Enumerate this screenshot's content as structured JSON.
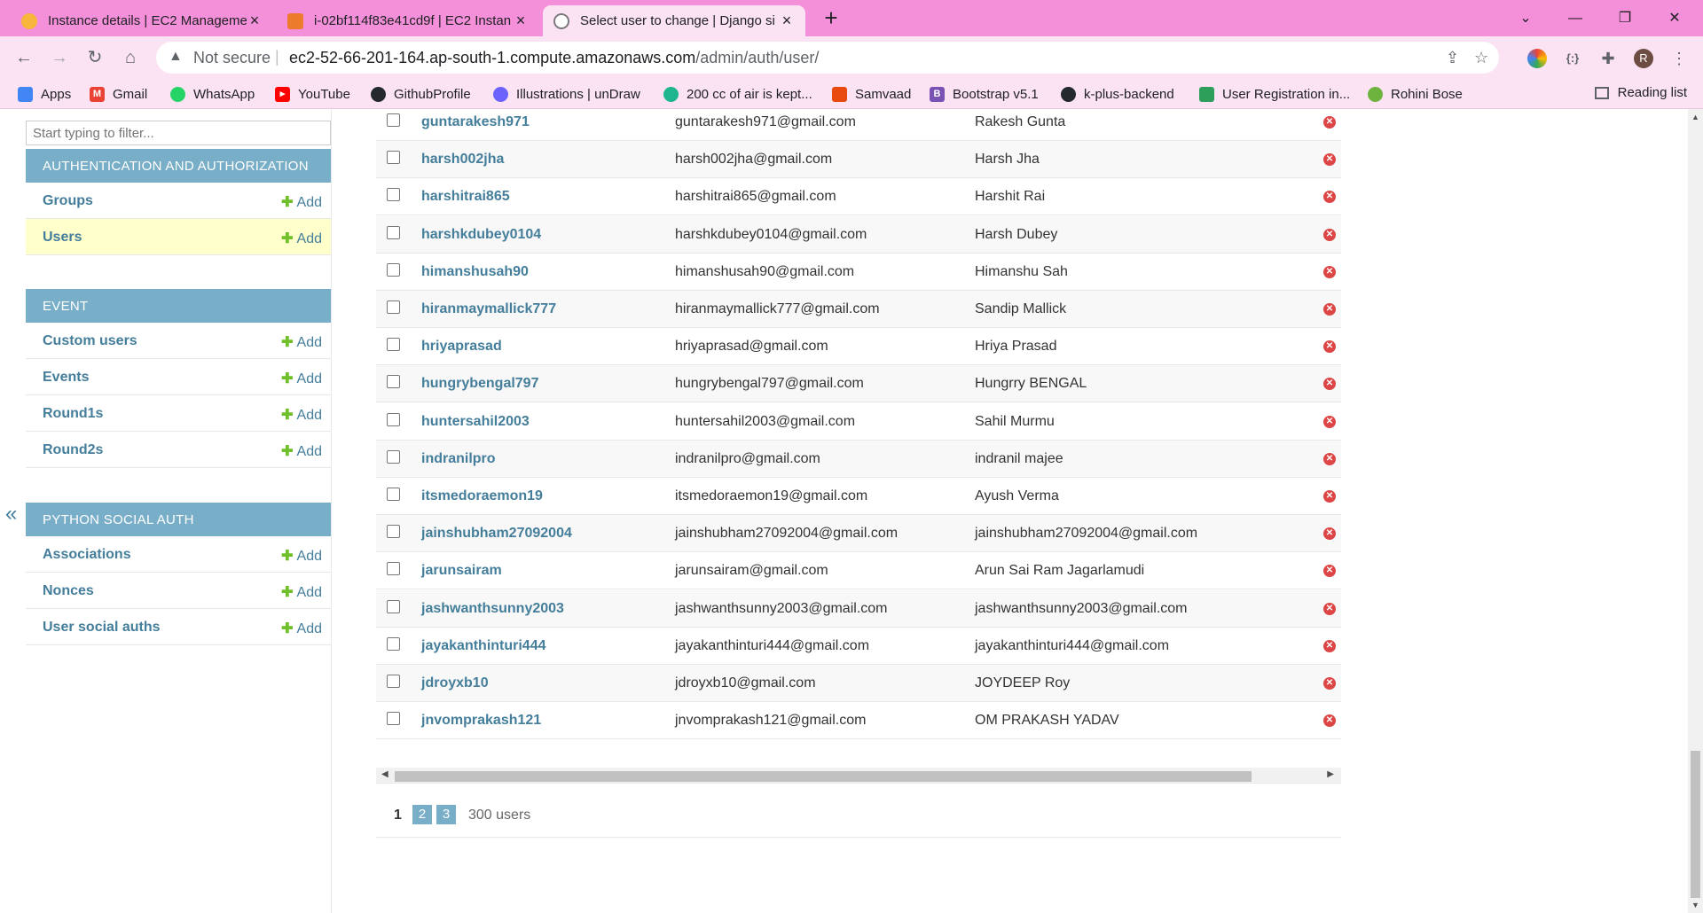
{
  "browser": {
    "tabs": [
      {
        "title": "Instance details | EC2 Manageme",
        "color": "#f6b73c"
      },
      {
        "title": "i-02bf114f83e41cd9f | EC2 Instan",
        "color": "#ec7b2b"
      },
      {
        "title": "Select user to change | Django si",
        "color": "#7a7a7a"
      }
    ],
    "new_tab": "+",
    "address": {
      "security": "Not secure",
      "host": "ec2-52-66-201-164.ap-south-1.compute.amazonaws.com",
      "path": "/admin/auth/user/"
    },
    "profile_initial": "R",
    "bookmarks": [
      {
        "label": "Apps",
        "icon": "apps-grid-icon",
        "color": "#4285f4"
      },
      {
        "label": "Gmail",
        "icon": "gmail-icon",
        "color": "#ea4335"
      },
      {
        "label": "WhatsApp",
        "icon": "whatsapp-icon",
        "color": "#25d366"
      },
      {
        "label": "YouTube",
        "icon": "youtube-icon",
        "color": "#ff0000"
      },
      {
        "label": "GithubProfile",
        "icon": "github-icon",
        "color": "#24292e"
      },
      {
        "label": "Illustrations | unDraw",
        "icon": "undraw-icon",
        "color": "#6c63ff"
      },
      {
        "label": "200 cc of air is kept...",
        "icon": "doubtnut-icon",
        "color": "#1fb58f"
      },
      {
        "label": "Samvaad",
        "icon": "samvaad-icon",
        "color": "#e8490f"
      },
      {
        "label": "Bootstrap v5.1",
        "icon": "bootstrap-icon",
        "color": "#7952b3"
      },
      {
        "label": "k-plus-backend",
        "icon": "github-icon",
        "color": "#24292e"
      },
      {
        "label": "User Registration in...",
        "icon": "document-icon",
        "color": "#2e9e5b"
      },
      {
        "label": "Rohini Bose",
        "icon": "leaf-icon",
        "color": "#6fb33f"
      }
    ],
    "reading_list": "Reading list"
  },
  "sidebar": {
    "filter_placeholder": "Start typing to filter...",
    "modules": [
      {
        "title": "AUTHENTICATION AND AUTHORIZATION",
        "models": [
          {
            "name": "Groups",
            "add": "Add"
          },
          {
            "name": "Users",
            "add": "Add"
          }
        ]
      },
      {
        "title": "EVENT",
        "models": [
          {
            "name": "Custom users",
            "add": "Add"
          },
          {
            "name": "Events",
            "add": "Add"
          },
          {
            "name": "Round1s",
            "add": "Add"
          },
          {
            "name": "Round2s",
            "add": "Add"
          }
        ]
      },
      {
        "title": "PYTHON SOCIAL AUTH",
        "models": [
          {
            "name": "Associations",
            "add": "Add"
          },
          {
            "name": "Nonces",
            "add": "Add"
          },
          {
            "name": "User social auths",
            "add": "Add"
          }
        ]
      }
    ],
    "collapse_label": "«"
  },
  "users": [
    {
      "username": "guntarakesh971",
      "email": "guntarakesh971@gmail.com",
      "name": "Rakesh Gunta"
    },
    {
      "username": "harsh002jha",
      "email": "harsh002jha@gmail.com",
      "name": "Harsh Jha"
    },
    {
      "username": "harshitrai865",
      "email": "harshitrai865@gmail.com",
      "name": "Harshit Rai"
    },
    {
      "username": "harshkdubey0104",
      "email": "harshkdubey0104@gmail.com",
      "name": "Harsh Dubey"
    },
    {
      "username": "himanshusah90",
      "email": "himanshusah90@gmail.com",
      "name": "Himanshu Sah"
    },
    {
      "username": "hiranmaymallick777",
      "email": "hiranmaymallick777@gmail.com",
      "name": "Sandip Mallick"
    },
    {
      "username": "hriyaprasad",
      "email": "hriyaprasad@gmail.com",
      "name": "Hriya Prasad"
    },
    {
      "username": "hungrybengal797",
      "email": "hungrybengal797@gmail.com",
      "name": "Hungrry BENGAL"
    },
    {
      "username": "huntersahil2003",
      "email": "huntersahil2003@gmail.com",
      "name": "Sahil Murmu"
    },
    {
      "username": "indranilpro",
      "email": "indranilpro@gmail.com",
      "name": "indranil majee"
    },
    {
      "username": "itsmedoraemon19",
      "email": "itsmedoraemon19@gmail.com",
      "name": "Ayush Verma"
    },
    {
      "username": "jainshubham27092004",
      "email": "jainshubham27092004@gmail.com",
      "name": "jainshubham27092004@gmail.com"
    },
    {
      "username": "jarunsairam",
      "email": "jarunsairam@gmail.com",
      "name": "Arun Sai Ram Jagarlamudi"
    },
    {
      "username": "jashwanthsunny2003",
      "email": "jashwanthsunny2003@gmail.com",
      "name": "jashwanthsunny2003@gmail.com"
    },
    {
      "username": "jayakanthinturi444",
      "email": "jayakanthinturi444@gmail.com",
      "name": "jayakanthinturi444@gmail.com"
    },
    {
      "username": "jdroyxb10",
      "email": "jdroyxb10@gmail.com",
      "name": "JOYDEEP Roy"
    },
    {
      "username": "jnvomprakash121",
      "email": "jnvomprakash121@gmail.com",
      "name": "OM PRAKASH YADAV"
    }
  ],
  "pagination": {
    "current": "1",
    "pages": [
      "2",
      "3"
    ],
    "count": "300 users"
  }
}
